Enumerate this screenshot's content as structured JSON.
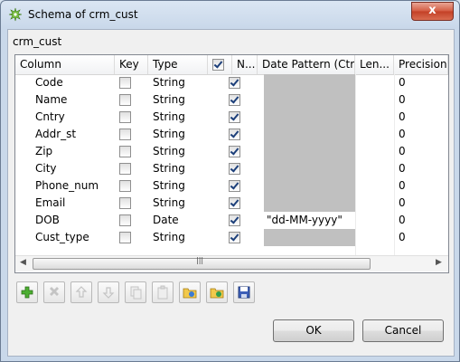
{
  "window": {
    "title": "Schema of crm_cust",
    "close_label": "x"
  },
  "schema_name": "crm_cust",
  "table": {
    "headers": [
      "Column",
      "Key",
      "Type",
      "",
      "N...",
      "Date Pattern (Ctr...",
      "Len...",
      "Precision"
    ],
    "rows": [
      {
        "column": "Code",
        "key": false,
        "type": "String",
        "nullable": true,
        "date_pattern": "",
        "length": "",
        "precision": "0"
      },
      {
        "column": "Name",
        "key": false,
        "type": "String",
        "nullable": true,
        "date_pattern": "",
        "length": "",
        "precision": "0"
      },
      {
        "column": "Cntry",
        "key": false,
        "type": "String",
        "nullable": true,
        "date_pattern": "",
        "length": "",
        "precision": "0"
      },
      {
        "column": "Addr_st",
        "key": false,
        "type": "String",
        "nullable": true,
        "date_pattern": "",
        "length": "",
        "precision": "0"
      },
      {
        "column": "Zip",
        "key": false,
        "type": "String",
        "nullable": true,
        "date_pattern": "",
        "length": "",
        "precision": "0"
      },
      {
        "column": "City",
        "key": false,
        "type": "String",
        "nullable": true,
        "date_pattern": "",
        "length": "",
        "precision": "0"
      },
      {
        "column": "Phone_num",
        "key": false,
        "type": "String",
        "nullable": true,
        "date_pattern": "",
        "length": "",
        "precision": "0"
      },
      {
        "column": "Email",
        "key": false,
        "type": "String",
        "nullable": true,
        "date_pattern": "",
        "length": "",
        "precision": "0"
      },
      {
        "column": "DOB",
        "key": false,
        "type": "Date",
        "nullable": true,
        "date_pattern": "\"dd-MM-yyyy\"",
        "length": "",
        "precision": "0"
      },
      {
        "column": "Cust_type",
        "key": false,
        "type": "String",
        "nullable": true,
        "date_pattern": "",
        "length": "",
        "precision": "0"
      }
    ]
  },
  "scrollbar": {
    "grip": "|||"
  },
  "toolbar": {
    "icons": [
      "add-icon",
      "delete-icon",
      "move-up-icon",
      "move-down-icon",
      "copy-icon",
      "paste-icon",
      "import-icon",
      "export-icon",
      "save-icon"
    ],
    "enabled": [
      true,
      false,
      false,
      false,
      false,
      false,
      true,
      true,
      true
    ]
  },
  "buttons": {
    "ok": "OK",
    "cancel": "Cancel"
  }
}
